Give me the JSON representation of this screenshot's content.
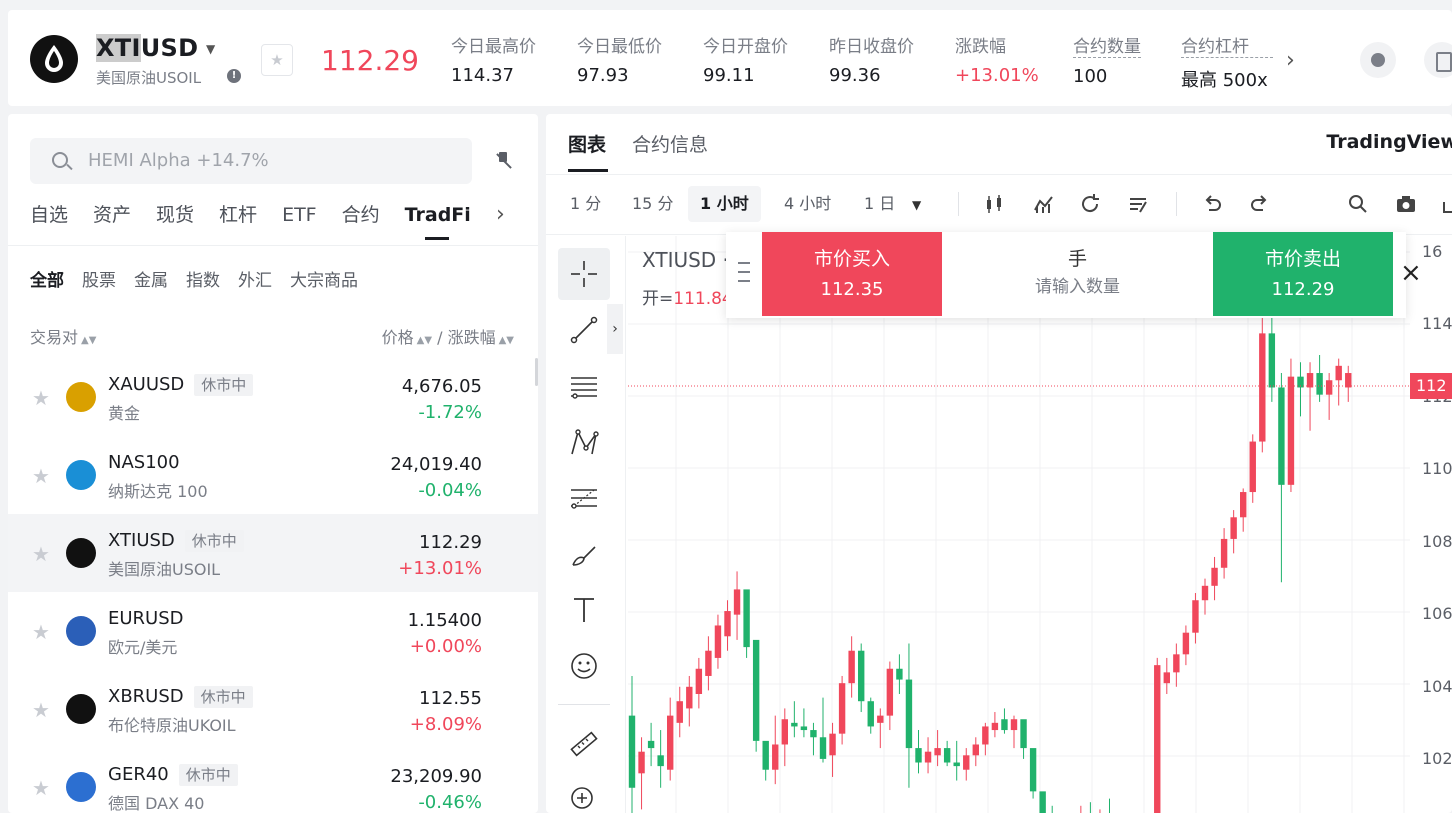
{
  "header": {
    "symbol": "XTIUSD",
    "symbol_prefix_hl": "XTI",
    "symbol_suffix": "USD",
    "symbol_name": "美国原油USOIL",
    "last_price": "112.29",
    "stats": [
      {
        "label": "今日最高价",
        "value": "114.37",
        "tone": "neutral"
      },
      {
        "label": "今日最低价",
        "value": "97.93",
        "tone": "neutral"
      },
      {
        "label": "今日开盘价",
        "value": "99.11",
        "tone": "neutral"
      },
      {
        "label": "昨日收盘价",
        "value": "99.36",
        "tone": "neutral"
      },
      {
        "label": "涨跌幅",
        "value": "+13.01%",
        "tone": "up"
      },
      {
        "label": "合约数量",
        "value": "100",
        "tone": "neutral"
      },
      {
        "label": "合约杠杆",
        "value": "最高 500x",
        "tone": "neutral"
      }
    ]
  },
  "search": {
    "placeholder": "HEMI Alpha +14.7%"
  },
  "categories": [
    "自选",
    "资产",
    "现货",
    "杠杆",
    "ETF",
    "合约",
    "TradFi"
  ],
  "active_category": "TradFi",
  "subcategories": [
    "全部",
    "股票",
    "金属",
    "指数",
    "外汇",
    "大宗商品"
  ],
  "list_head": {
    "pair": "交易对",
    "price": "价格",
    "sep": "/",
    "change": "涨跌幅"
  },
  "market_list": [
    {
      "symbol": "XAUUSD",
      "tag": "休市中",
      "name": "黄金",
      "price": "4,676.05",
      "change": "-1.72%",
      "dir": "down",
      "coin_color": "#d9a000",
      "selected": false
    },
    {
      "symbol": "NAS100",
      "tag": "",
      "name": "纳斯达克 100",
      "price": "24,019.40",
      "change": "-0.04%",
      "dir": "down",
      "coin_color": "#1a8fd6",
      "selected": false
    },
    {
      "symbol": "XTIUSD",
      "tag": "休市中",
      "name": "美国原油USOIL",
      "price": "112.29",
      "change": "+13.01%",
      "dir": "up",
      "coin_color": "#111111",
      "selected": true
    },
    {
      "symbol": "EURUSD",
      "tag": "",
      "name": "欧元/美元",
      "price": "1.15400",
      "change": "+0.00%",
      "dir": "up",
      "coin_color": "#2b5fb8",
      "selected": false
    },
    {
      "symbol": "XBRUSD",
      "tag": "休市中",
      "name": "布伦特原油UKOIL",
      "price": "112.55",
      "change": "+8.09%",
      "dir": "up",
      "coin_color": "#111111",
      "selected": false
    },
    {
      "symbol": "GER40",
      "tag": "休市中",
      "name": "德国 DAX 40",
      "price": "23,209.90",
      "change": "-0.46%",
      "dir": "down",
      "coin_color": "#2c6fd1",
      "selected": false
    }
  ],
  "chart_panel": {
    "tabs": [
      "图表",
      "合约信息"
    ],
    "active_tab": "图表",
    "provider": "TradingView",
    "timeframes": [
      "1 分",
      "15 分",
      "1 小时",
      "4 小时",
      "1 日"
    ],
    "active_timeframe": "1 小时",
    "legend_symbol": "XTIUSD ·",
    "legend_open_label": "开=",
    "legend_open_value": "111.84",
    "current_price_tag": "112"
  },
  "trade": {
    "buy_label": "市价买入",
    "buy_price": "112.35",
    "unit": "手",
    "qty_placeholder": "请输入数量",
    "sell_label": "市价卖出",
    "sell_price": "112.29"
  },
  "chart_data": {
    "type": "candlestick",
    "title": "",
    "ylim": [
      100.5,
      116.5
    ],
    "y_ticks": [
      "16",
      "114",
      "112",
      "110",
      "108",
      "106",
      "104",
      "102"
    ],
    "candles": [
      [
        103.2,
        104.3,
        100.3,
        101.2
      ],
      [
        101.6,
        102.6,
        100.6,
        102.2
      ],
      [
        102.5,
        103.0,
        101.8,
        102.3
      ],
      [
        102.1,
        102.8,
        101.2,
        101.8
      ],
      [
        101.7,
        103.7,
        101.4,
        103.2
      ],
      [
        103.0,
        104.0,
        102.6,
        103.6
      ],
      [
        103.4,
        104.3,
        102.9,
        104.0
      ],
      [
        103.8,
        104.8,
        103.4,
        104.5
      ],
      [
        104.3,
        105.4,
        103.9,
        105.0
      ],
      [
        104.8,
        106.0,
        104.5,
        105.7
      ],
      [
        105.4,
        106.4,
        105.0,
        106.1
      ],
      [
        106.0,
        107.2,
        105.3,
        106.7
      ],
      [
        106.7,
        106.6,
        104.8,
        105.1
      ],
      [
        105.3,
        105.2,
        102.2,
        102.5
      ],
      [
        102.5,
        102.4,
        101.4,
        101.7
      ],
      [
        101.7,
        103.2,
        101.3,
        102.4
      ],
      [
        102.4,
        103.4,
        101.8,
        103.1
      ],
      [
        103.0,
        103.6,
        102.6,
        102.9
      ],
      [
        102.9,
        103.4,
        102.6,
        102.8
      ],
      [
        102.8,
        103.0,
        102.1,
        102.6
      ],
      [
        102.6,
        103.7,
        101.9,
        102.0
      ],
      [
        102.1,
        103.0,
        101.5,
        102.7
      ],
      [
        102.7,
        104.3,
        102.4,
        104.1
      ],
      [
        104.1,
        105.4,
        103.7,
        105.0
      ],
      [
        105.0,
        105.2,
        103.3,
        103.6
      ],
      [
        103.6,
        103.7,
        102.7,
        102.9
      ],
      [
        103.0,
        103.4,
        102.3,
        103.2
      ],
      [
        103.2,
        104.7,
        102.8,
        104.5
      ],
      [
        104.5,
        104.9,
        103.8,
        104.2
      ],
      [
        104.2,
        105.2,
        101.2,
        102.3
      ],
      [
        102.3,
        102.8,
        101.6,
        101.9
      ],
      [
        101.9,
        102.6,
        101.6,
        102.2
      ],
      [
        102.1,
        102.8,
        101.8,
        102.3
      ],
      [
        102.3,
        102.5,
        101.8,
        101.9
      ],
      [
        101.9,
        102.5,
        101.4,
        101.8
      ],
      [
        101.7,
        102.3,
        101.4,
        102.1
      ],
      [
        102.1,
        102.6,
        101.8,
        102.4
      ],
      [
        102.4,
        103.0,
        102.1,
        102.9
      ],
      [
        102.8,
        103.3,
        102.6,
        103.0
      ],
      [
        103.1,
        103.4,
        102.7,
        102.8
      ],
      [
        102.8,
        103.2,
        102.3,
        103.1
      ],
      [
        103.1,
        103.0,
        102.0,
        102.3
      ],
      [
        102.3,
        102.1,
        100.9,
        101.1
      ],
      [
        101.1,
        101.0,
        100.1,
        100.4
      ],
      [
        100.4,
        100.7,
        99.8,
        100.0
      ],
      [
        100.0,
        100.3,
        99.5,
        99.8
      ],
      [
        99.8,
        100.4,
        99.4,
        100.2
      ],
      [
        100.2,
        100.7,
        99.8,
        100.5
      ],
      [
        100.5,
        100.8,
        99.9,
        100.1
      ],
      [
        100.1,
        100.6,
        99.7,
        100.4
      ],
      [
        100.4,
        100.9,
        99.9,
        100.2
      ],
      [
        100.2,
        100.5,
        99.6,
        99.9
      ],
      [
        99.9,
        100.2,
        99.4,
        99.7
      ],
      [
        99.7,
        100.1,
        99.3,
        99.9
      ],
      [
        99.9,
        100.3,
        99.5,
        100.1
      ],
      [
        100.1,
        104.8,
        99.8,
        104.6
      ],
      [
        104.1,
        104.8,
        103.8,
        104.4
      ],
      [
        104.4,
        105.2,
        104.0,
        104.9
      ],
      [
        104.9,
        105.7,
        104.6,
        105.5
      ],
      [
        105.5,
        106.6,
        105.2,
        106.4
      ],
      [
        106.4,
        107.0,
        106.0,
        106.8
      ],
      [
        106.8,
        107.6,
        106.4,
        107.3
      ],
      [
        107.3,
        108.4,
        107.0,
        108.1
      ],
      [
        108.1,
        108.9,
        107.7,
        108.7
      ],
      [
        108.7,
        109.5,
        108.3,
        109.4
      ],
      [
        109.4,
        111.0,
        109.1,
        110.8
      ],
      [
        110.8,
        114.6,
        110.5,
        113.8
      ],
      [
        113.8,
        114.4,
        111.9,
        112.3
      ],
      [
        112.3,
        112.7,
        106.9,
        109.6
      ],
      [
        109.6,
        113.1,
        109.4,
        112.6
      ],
      [
        112.6,
        113.0,
        111.5,
        112.3
      ],
      [
        112.3,
        113.0,
        111.1,
        112.7
      ],
      [
        112.7,
        113.2,
        111.9,
        112.1
      ],
      [
        112.1,
        112.7,
        111.4,
        112.5
      ],
      [
        112.5,
        113.1,
        111.8,
        112.9
      ],
      [
        112.3,
        112.9,
        111.9,
        112.7
      ]
    ]
  }
}
